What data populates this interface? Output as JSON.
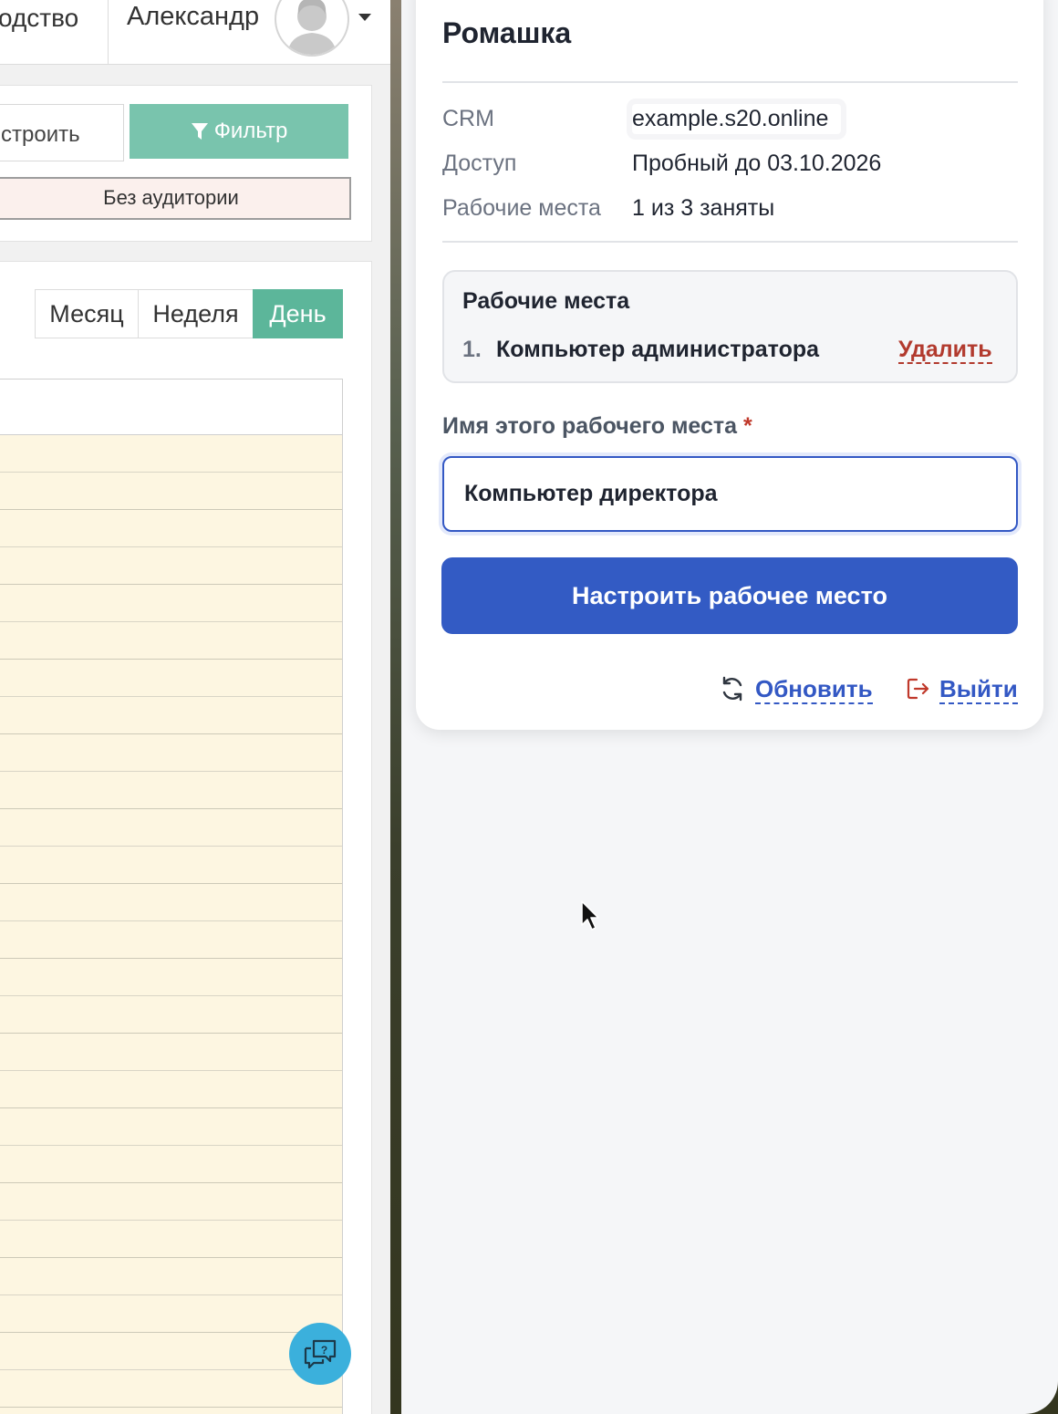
{
  "background_app": {
    "header": {
      "manual_text": "одство",
      "user_name": "Александр"
    },
    "toolbar": {
      "setup_label": "строить",
      "filter_label": "Фильтр",
      "no_audience_label": "Без аудитории"
    },
    "view_switch": {
      "month": "Месяц",
      "week": "Неделя",
      "day": "День",
      "active": "День"
    },
    "colors": {
      "filter_button": "#79c4ad",
      "active_view": "#5cb69a",
      "calendar_bg": "#fdf6e1",
      "help_button": "#3bb0dc"
    }
  },
  "panel": {
    "title": "Ромашка",
    "info": {
      "crm_label": "CRM",
      "crm_value": "example.s20.online",
      "access_label": "Доступ",
      "access_value": "Пробный до 03.10.2026",
      "seats_label": "Рабочие места",
      "seats_value": "1 из 3 заняты"
    },
    "workstations": {
      "title": "Рабочие места",
      "items": [
        {
          "number": "1.",
          "name": "Компьютер администратора",
          "delete_label": "Удалить"
        }
      ]
    },
    "form": {
      "field_label": "Имя этого рабочего места",
      "required_mark": "*",
      "field_value": "Компьютер директора",
      "submit_label": "Настроить рабочее место"
    },
    "footer": {
      "refresh_label": "Обновить",
      "logout_label": "Выйти"
    },
    "colors": {
      "primary": "#335bc4",
      "danger": "#b23a2e"
    }
  }
}
